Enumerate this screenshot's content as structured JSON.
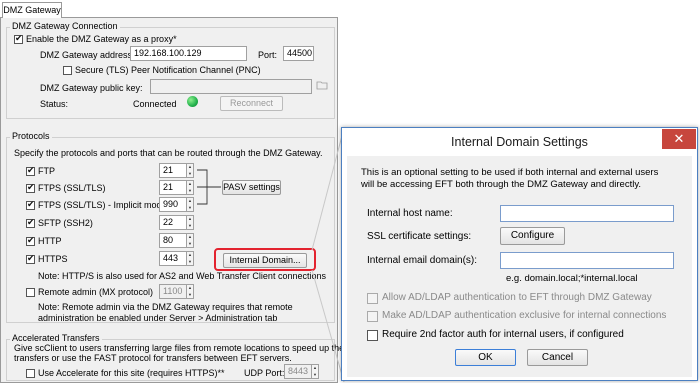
{
  "tab_label": "DMZ Gateway",
  "dmz_connection": {
    "group_title": "DMZ Gateway Connection",
    "enable_label": "Enable the DMZ Gateway as a proxy*",
    "address_label": "DMZ Gateway address:",
    "address_value": "192.168.100.129",
    "port_label": "Port:",
    "port_value": "44500",
    "secure_label": "Secure (TLS) Peer Notification Channel (PNC)",
    "pubkey_label": "DMZ Gateway public key:",
    "status_label": "Status:",
    "status_value": "Connected",
    "status_color": "#22b14c",
    "reconnect_label": "Reconnect"
  },
  "protocols": {
    "group_title": "Protocols",
    "description": "Specify the protocols and ports that can be routed through the DMZ Gateway.",
    "items": [
      {
        "label": "FTP",
        "port": "21"
      },
      {
        "label": "FTPS (SSL/TLS)",
        "port": "21"
      },
      {
        "label": "FTPS (SSL/TLS) - Implicit mode",
        "port": "990"
      },
      {
        "label": "SFTP (SSH2)",
        "port": "22"
      },
      {
        "label": "HTTP",
        "port": "80"
      },
      {
        "label": "HTTPS",
        "port": "443"
      }
    ],
    "pasv_label": "PASV settings",
    "internal_domain_label": "Internal Domain...",
    "https_note": "Note: HTTP/S is also used for AS2 and Web Transfer Client connections",
    "remote_admin_label": "Remote admin (MX protocol)",
    "remote_admin_port": "1100",
    "remote_note_1": "Note: Remote admin via the DMZ Gateway requires that remote",
    "remote_note_2": "administration be enabled under Server > Administration tab"
  },
  "accelerated": {
    "group_title": "Accelerated Transfers",
    "desc_1": "Give scClient to users transferring large files from remote locations to speed up their",
    "desc_2": "transfers or use the FAST protocol for transfers between EFT servers.",
    "use_label": "Use Accelerate for this site (requires HTTPS)**",
    "udp_label": "UDP Port:",
    "udp_value": "8443"
  },
  "dialog": {
    "title": "Internal Domain Settings",
    "close_glyph": "✕",
    "intro_1": "This is an optional setting to be used if both internal and external users",
    "intro_2": "will be accessing EFT both through the DMZ Gateway and directly.",
    "host_label": "Internal host name:",
    "host_value": "",
    "ssl_label": "SSL certificate settings:",
    "configure_label": "Configure",
    "email_label": "Internal email domain(s):",
    "email_value": "",
    "email_hint": "e.g. domain.local;*internal.local",
    "allow_ad_label": "Allow AD/LDAP authentication to EFT through DMZ Gateway",
    "make_ad_label": "Make AD/LDAP authentication exclusive for internal connections",
    "require_2fa_label": "Require 2nd factor auth for internal users, if configured",
    "ok_label": "OK",
    "cancel_label": "Cancel"
  },
  "highlight_color": "#e3232f"
}
